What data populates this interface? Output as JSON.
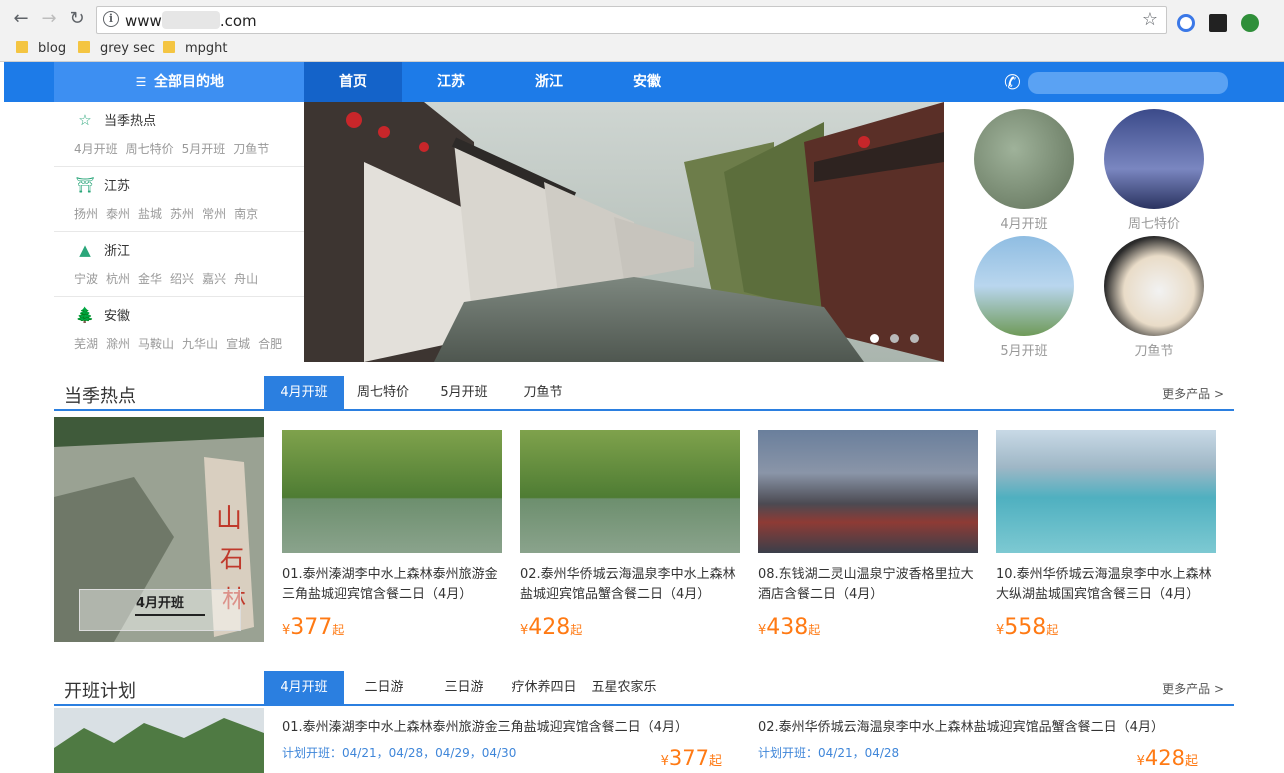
{
  "browser": {
    "url_prefix": "www",
    "url_suffix": ".com",
    "bookmarks": [
      "blog",
      "grey sec",
      "mpght"
    ]
  },
  "nav": {
    "all_destinations": "全部目的地",
    "items": [
      "首页",
      "江苏",
      "浙江",
      "安徽"
    ]
  },
  "sidemenu": [
    {
      "title": "当季热点",
      "icon": "star-icon",
      "links": [
        "4月开班",
        "周七特价",
        "5月开班",
        "刀鱼节"
      ]
    },
    {
      "title": "江苏",
      "icon": "pagoda-icon",
      "links": [
        "扬州",
        "泰州",
        "盐城",
        "苏州",
        "常州",
        "南京"
      ]
    },
    {
      "title": "浙江",
      "icon": "mountain-icon",
      "links": [
        "宁波",
        "杭州",
        "金华",
        "绍兴",
        "嘉兴",
        "舟山"
      ]
    },
    {
      "title": "安徽",
      "icon": "pine-icon",
      "links": [
        "芜湖",
        "滁州",
        "马鞍山",
        "九华山",
        "宣城",
        "合肥"
      ]
    }
  ],
  "circles": [
    "4月开班",
    "周七特价",
    "5月开班",
    "刀鱼节"
  ],
  "section1": {
    "title": "当季热点",
    "tabs": [
      "4月开班",
      "周七特价",
      "5月开班",
      "刀鱼节"
    ],
    "more": "更多产品 >",
    "feature_caption": "4月开班",
    "cards": [
      {
        "title": "01.泰州溱湖李中水上森林泰州旅游金三角盐城迎宾馆含餐二日（4月）",
        "currency": "¥",
        "price": "377",
        "unit": "起"
      },
      {
        "title": "02.泰州华侨城云海温泉李中水上森林盐城迎宾馆品蟹含餐二日（4月）",
        "currency": "¥",
        "price": "428",
        "unit": "起"
      },
      {
        "title": "08.东钱湖二灵山温泉宁波香格里拉大酒店含餐二日（4月）",
        "currency": "¥",
        "price": "438",
        "unit": "起"
      },
      {
        "title": "10.泰州华侨城云海温泉李中水上森林大纵湖盐城国宾馆含餐三日（4月）",
        "currency": "¥",
        "price": "558",
        "unit": "起"
      }
    ]
  },
  "section2": {
    "title": "开班计划",
    "tabs": [
      "4月开班",
      "二日游",
      "三日游",
      "疗休养四日",
      "五星农家乐"
    ],
    "more": "更多产品 >",
    "plans": [
      {
        "title": "01.泰州溱湖李中水上森林泰州旅游金三角盐城迎宾馆含餐二日（4月）",
        "dates": "计划开班：04/21，04/28，04/29，04/30",
        "currency": "¥",
        "price": "377",
        "unit": "起"
      },
      {
        "title": "02.泰州华侨城云海温泉李中水上森林盐城迎宾馆品蟹含餐二日（4月）",
        "dates": "计划开班：04/21，04/28",
        "currency": "¥",
        "price": "428",
        "unit": "起"
      }
    ]
  }
}
